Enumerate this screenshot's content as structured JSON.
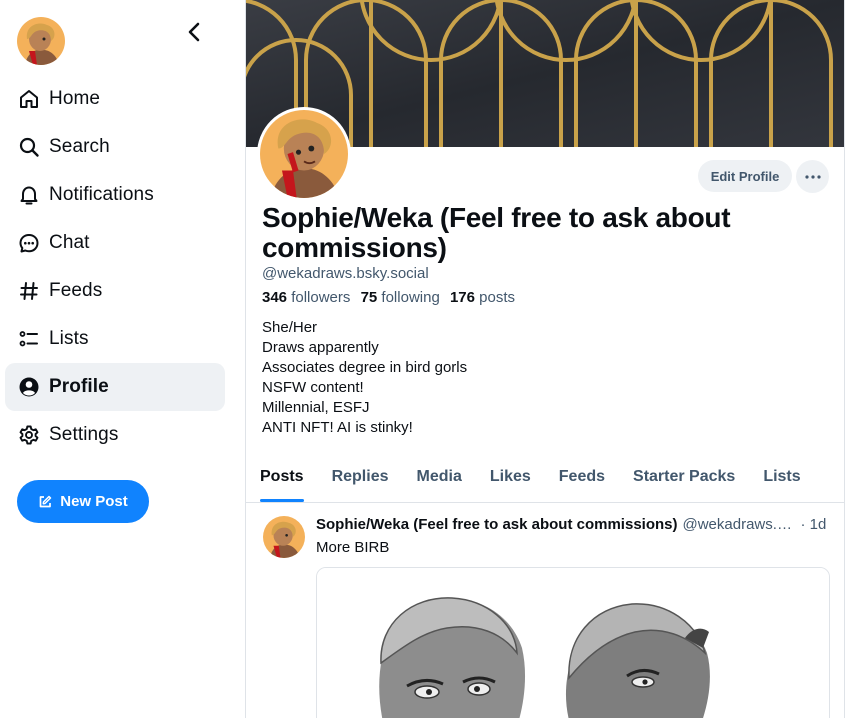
{
  "sidebar": {
    "avatar_icon": "user-avatar",
    "collapse_icon": "chevron-left-icon",
    "nav": [
      {
        "label": "Home",
        "icon": "home-icon"
      },
      {
        "label": "Search",
        "icon": "search-icon"
      },
      {
        "label": "Notifications",
        "icon": "bell-icon"
      },
      {
        "label": "Chat",
        "icon": "chat-icon"
      },
      {
        "label": "Feeds",
        "icon": "hash-icon"
      },
      {
        "label": "Lists",
        "icon": "list-icon"
      },
      {
        "label": "Profile",
        "icon": "profile-icon",
        "active": true
      },
      {
        "label": "Settings",
        "icon": "gear-icon"
      }
    ],
    "new_post_label": "New Post"
  },
  "profile": {
    "display_name": "Sophie/Weka (Feel free to ask about commissions)",
    "handle": "@wekadraws.bsky.social",
    "edit_label": "Edit Profile",
    "stats": {
      "followers_count": "346",
      "followers_label": "followers",
      "following_count": "75",
      "following_label": "following",
      "posts_count": "176",
      "posts_label": "posts"
    },
    "bio": [
      "She/Her",
      "Draws apparently",
      "Associates degree in bird gorls",
      "NSFW content!",
      "Millennial, ESFJ",
      "ANTI NFT! AI is stinky!"
    ]
  },
  "tabs": [
    "Posts",
    "Replies",
    "Media",
    "Likes",
    "Feeds",
    "Starter Packs",
    "Lists"
  ],
  "active_tab": "Posts",
  "post": {
    "author": "Sophie/Weka (Feel free to ask about commissions)",
    "handle": "@wekadraws.bsky.social",
    "time": "· 1d",
    "text": "More BIRB"
  },
  "colors": {
    "accent": "#1083fe",
    "banner_bg": "#2c2f36",
    "banner_arches": "#c9a24a",
    "text_secondary": "#42576c"
  }
}
